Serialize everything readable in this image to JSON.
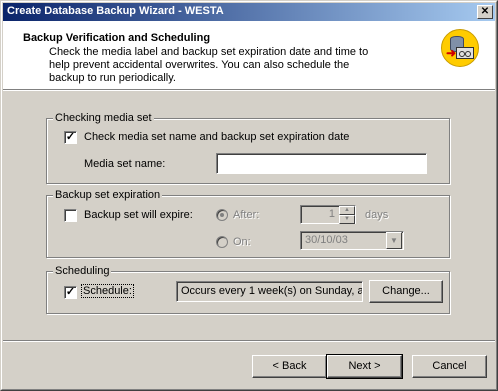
{
  "window": {
    "title": "Create Database Backup Wizard - WESTA",
    "close_glyph": "✕"
  },
  "header": {
    "title": "Backup Verification and Scheduling",
    "description": "Check the media label and backup set expiration date and time to help prevent accidental overwrites. You can also schedule the backup to run periodically.",
    "icon": "database-backup-icon"
  },
  "media_set": {
    "legend": "Checking media set",
    "check_label": "Check media set name and backup set expiration date",
    "checked": true,
    "name_label": "Media set name:",
    "name_value": ""
  },
  "expiration": {
    "legend": "Backup set expiration",
    "check_label": "Backup set will expire:",
    "checked": false,
    "after_label": "After:",
    "after_selected": true,
    "after_value": "1",
    "after_unit": "days",
    "on_label": "On:",
    "on_value": "30/10/03"
  },
  "scheduling": {
    "legend": "Scheduling",
    "check_label": "Schedule:",
    "checked": true,
    "schedule_text": "Occurs every 1 week(s) on Sunday, a",
    "change_label": "Change..."
  },
  "footer": {
    "back_label": "< Back",
    "next_label": "Next >",
    "cancel_label": "Cancel"
  }
}
